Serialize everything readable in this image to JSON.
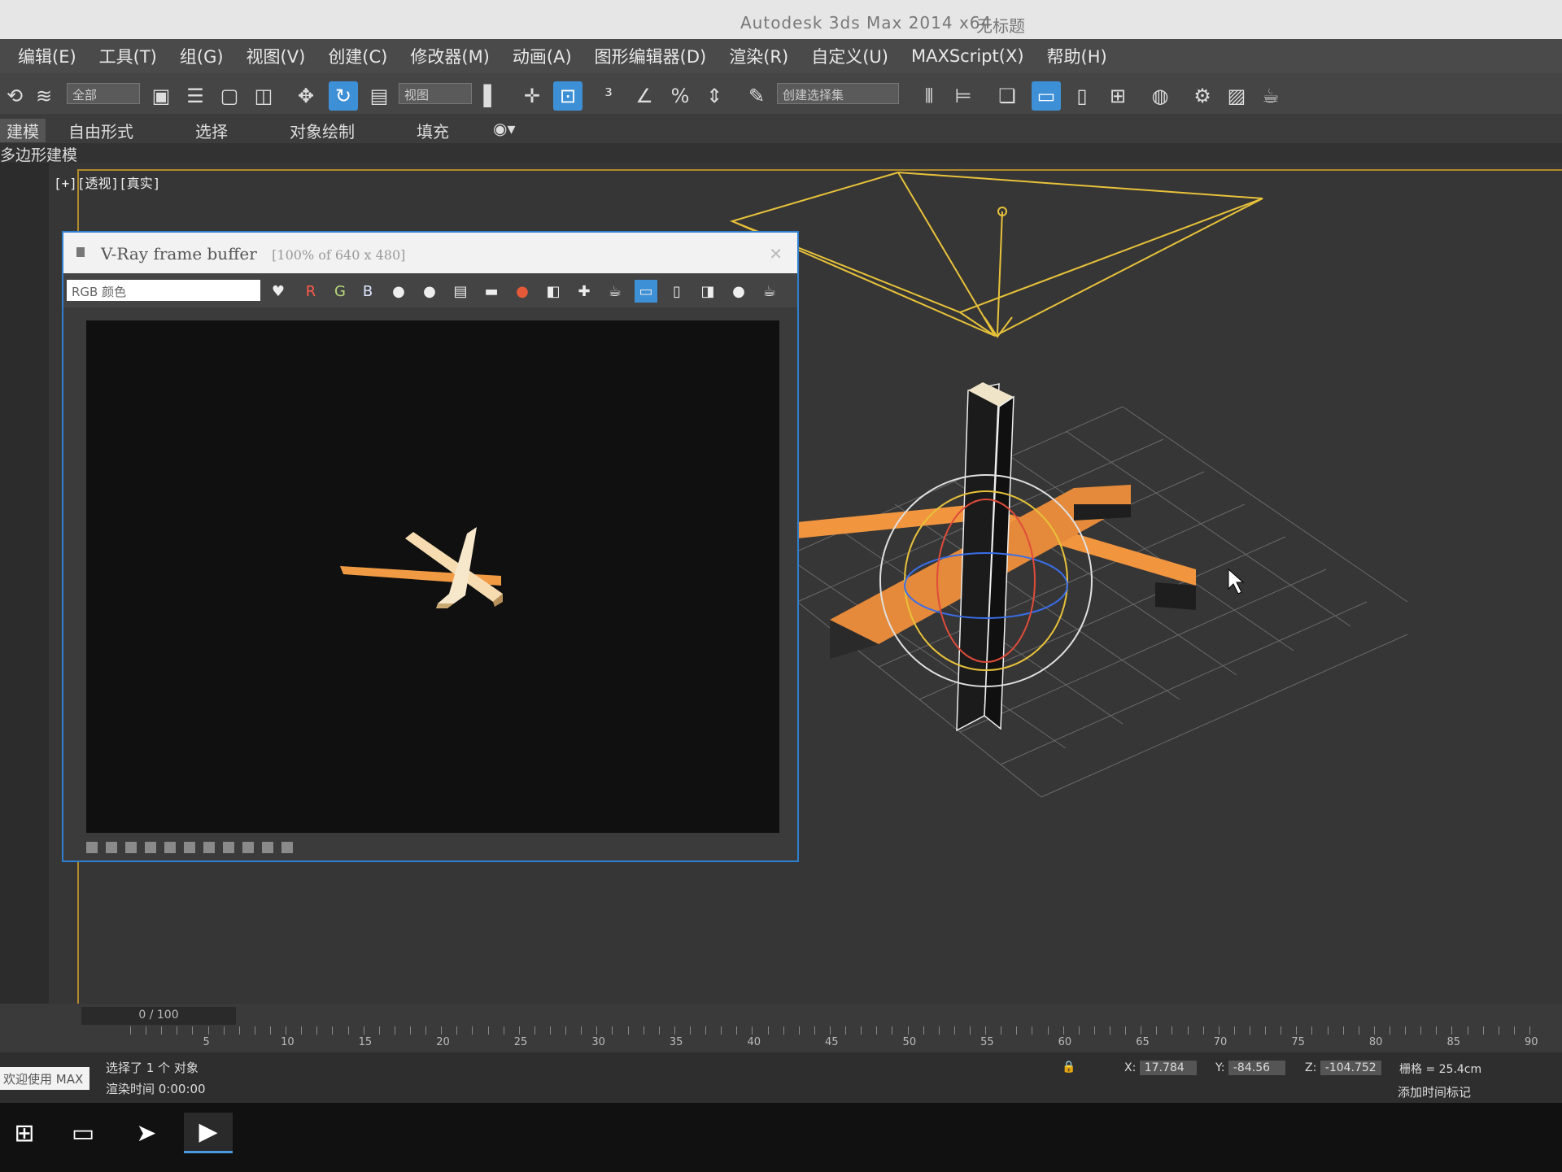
{
  "window": {
    "title": "Autodesk 3ds Max 2014 x64",
    "document": "无标题"
  },
  "menu": [
    "编辑(E)",
    "工具(T)",
    "组(G)",
    "视图(V)",
    "创建(C)",
    "修改器(M)",
    "动画(A)",
    "图形编辑器(D)",
    "渲染(R)",
    "自定义(U)",
    "MAXScript(X)",
    "帮助(H)"
  ],
  "toolbar": {
    "filter_select": "全部",
    "view_select": "视图",
    "selection_set": "创建选择集"
  },
  "ribbon": {
    "tabs": [
      "建模",
      "自由形式",
      "选择",
      "对象绘制",
      "填充"
    ],
    "subtitle": "多边形建模"
  },
  "viewport": {
    "label": "[+][透视][真实]"
  },
  "vfb": {
    "title": "V-Ray frame buffer",
    "subtitle": "[100% of 640 x 480]",
    "channel": "RGB 颜色",
    "channel_buttons": [
      "R",
      "G",
      "B"
    ]
  },
  "timeline": {
    "frame": "0 / 100",
    "ticks": [
      "5",
      "10",
      "15",
      "20",
      "25",
      "30",
      "35",
      "40",
      "45",
      "50",
      "55",
      "60",
      "65",
      "70",
      "75",
      "80",
      "85",
      "90"
    ]
  },
  "status": {
    "welcome": "欢迎使用 MAX",
    "selection": "选择了 1 个 对象",
    "render_time": "渲染时间 0:00:00",
    "x_label": "X:",
    "x": "17.784",
    "y_label": "Y:",
    "y": "-84.56",
    "z_label": "Z:",
    "z": "-104.752",
    "grid": "栅格 = 25.4cm",
    "add_time_tag": "添加时间标记"
  },
  "colors": {
    "accent": "#3d8fd6",
    "selection": "#e8c23a",
    "object": "#e8963a"
  }
}
